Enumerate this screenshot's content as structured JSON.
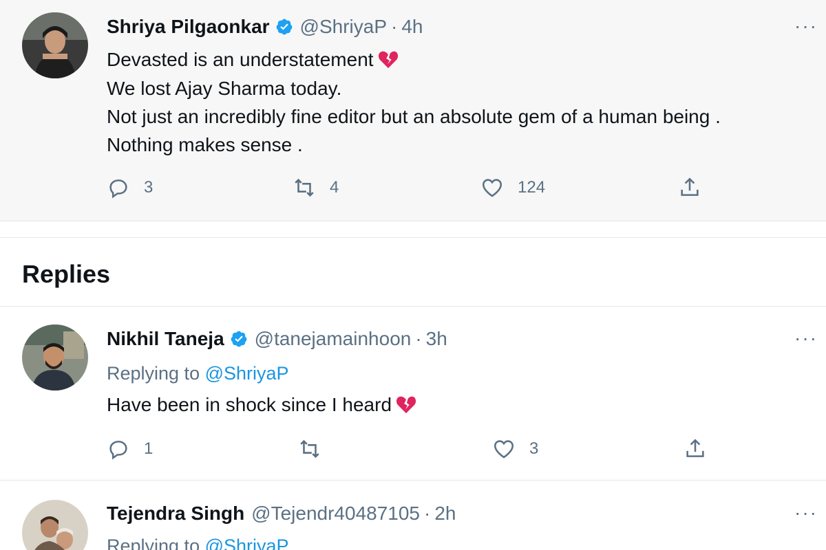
{
  "main_tweet": {
    "name": "Shriya Pilgaonkar",
    "handle": "@ShriyaP",
    "separator": "·",
    "time": "4h",
    "lines": [
      "Devasted is an understatement",
      "We lost Ajay Sharma today.",
      "Not just an incredibly fine editor but an absolute gem of a human being .",
      "Nothing makes sense ."
    ],
    "reply_count": "3",
    "retweet_count": "4",
    "like_count": "124",
    "more_label": "···"
  },
  "replies_heading": "Replies",
  "replies": [
    {
      "name": "Nikhil Taneja",
      "handle": "@tanejamainhoon",
      "separator": "·",
      "time": "3h",
      "replying_prefix": "Replying to",
      "replying_to": "@ShriyaP",
      "text": "Have been in shock since I heard",
      "reply_count": "1",
      "retweet_count": "",
      "like_count": "3",
      "more_label": "···"
    },
    {
      "name": "Tejendra Singh",
      "handle": "@Tejendr40487105",
      "separator": "·",
      "time": "2h",
      "replying_prefix": "Replying to",
      "replying_to": "@ShriyaP",
      "more_label": "···"
    }
  ],
  "colors": {
    "accent": "#1b95e0",
    "muted": "#5b7083",
    "verified": "#1da1f2",
    "broken_heart": "#e0245e"
  },
  "icons": {
    "reply": "reply-icon",
    "retweet": "retweet-icon",
    "like": "like-icon",
    "share": "share-icon",
    "verified": "verified-badge-icon",
    "broken_heart": "broken-heart-emoji"
  }
}
